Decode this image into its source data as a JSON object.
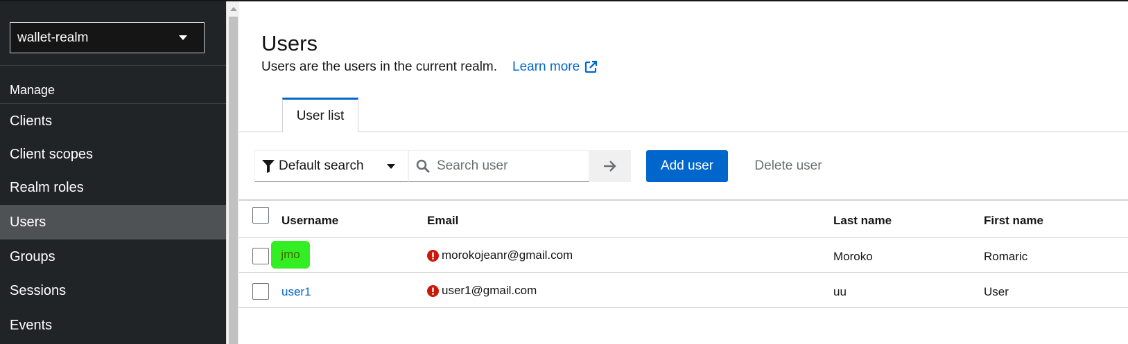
{
  "sidebar": {
    "realm": "wallet-realm",
    "section": "Manage",
    "items": [
      {
        "label": "Clients"
      },
      {
        "label": "Client scopes"
      },
      {
        "label": "Realm roles"
      },
      {
        "label": "Users"
      },
      {
        "label": "Groups"
      },
      {
        "label": "Sessions"
      },
      {
        "label": "Events"
      }
    ],
    "active_item": "Users"
  },
  "page": {
    "title": "Users",
    "subtitle": "Users are the users in the current realm.",
    "learn_more": "Learn more"
  },
  "tabs": [
    {
      "label": "User list",
      "active": true
    }
  ],
  "toolbar": {
    "filter_label": "Default search",
    "search_placeholder": "Search user",
    "add_user": "Add user",
    "delete_user": "Delete user"
  },
  "table": {
    "columns": [
      "Username",
      "Email",
      "Last name",
      "First name"
    ],
    "rows": [
      {
        "username": "jmo",
        "email": "morokojeanr@gmail.com",
        "email_warning": true,
        "last_name": "Moroko",
        "first_name": "Romaric",
        "highlighted": true
      },
      {
        "username": "user1",
        "email": "user1@gmail.com",
        "email_warning": true,
        "last_name": "uu",
        "first_name": "User",
        "highlighted": false
      }
    ]
  },
  "colors": {
    "sidebar_bg": "#212427",
    "active_nav_bg": "#4f5255",
    "primary": "#0066cc",
    "highlight": "#33ee22",
    "warning_icon": "#c9190b"
  },
  "icons": [
    "caret-down-icon",
    "external-link-icon",
    "filter-icon",
    "search-icon",
    "arrow-right-icon",
    "exclamation-circle-icon"
  ]
}
